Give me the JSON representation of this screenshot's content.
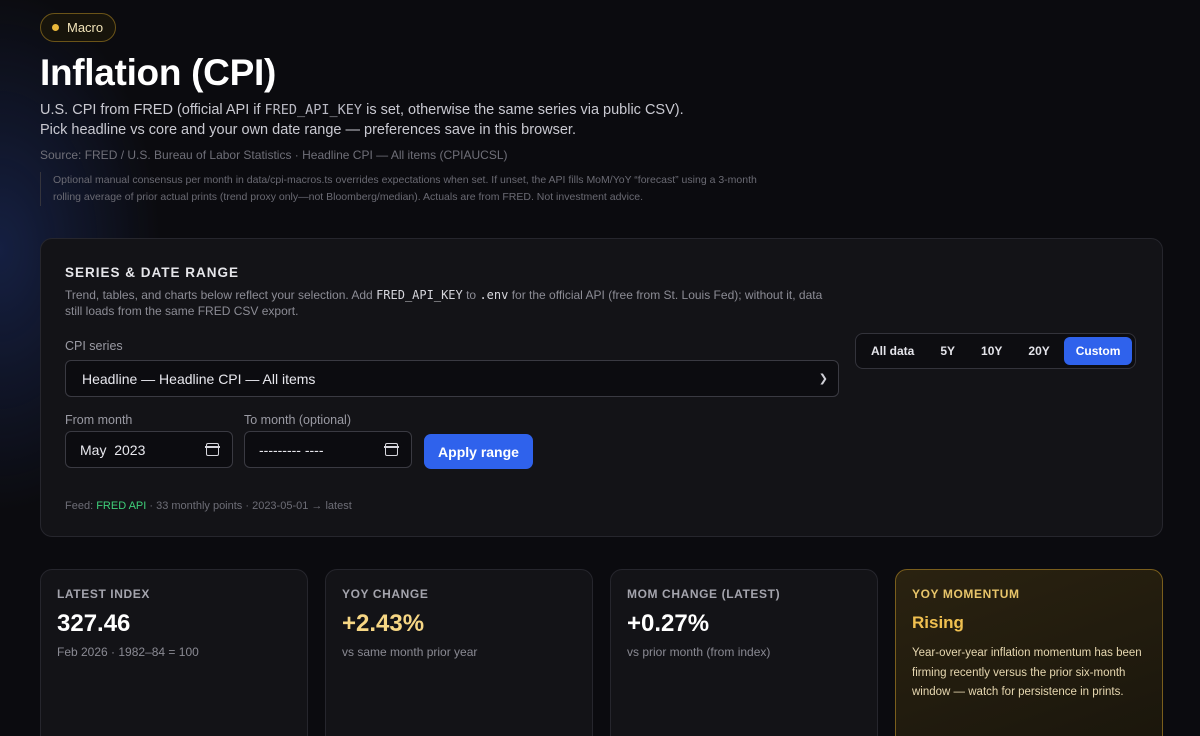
{
  "badge": {
    "label": "Macro"
  },
  "header": {
    "title": "Inflation (CPI)",
    "desc_1": "U.S. CPI from FRED (official API if ",
    "desc_code": "FRED_API_KEY",
    "desc_2": " is set, otherwise the same series via public CSV). Pick headline vs core and your own date range — preferences save in this browser.",
    "source": "Source: FRED / U.S. Bureau of Labor Statistics · Headline CPI — All items (CPIAUCSL)",
    "note": "Optional manual consensus per month in data/cpi-macros.ts overrides expectations when set. If unset, the API fills MoM/YoY “forecast” using a 3-month rolling average of prior actual prints (trend proxy only—not Bloomberg/median). Actuals are from FRED. Not investment advice."
  },
  "panel": {
    "title": "SERIES & DATE RANGE",
    "desc_1": "Trend, tables, and charts below reflect your selection. Add ",
    "desc_code_1": "FRED_API_KEY",
    "desc_2": " to ",
    "desc_code_2": ".env",
    "desc_3": " for the official API (free from St. Louis Fed); without it, data still loads from the same FRED CSV export.",
    "ranges": [
      "All data",
      "5Y",
      "10Y",
      "20Y",
      "Custom"
    ],
    "series_label": "CPI series",
    "series_value": "Headline — Headline CPI — All items",
    "from_label": "From month",
    "from_value": "May  2023",
    "to_label": "To month (optional)",
    "to_value": "--------- ----",
    "apply_label": "Apply range",
    "feed_prefix": "Feed: ",
    "feed_api": "FRED API",
    "feed_suffix": " · 33 monthly points · 2023-05-01 → latest"
  },
  "cards": {
    "latest": {
      "label": "LATEST INDEX",
      "value": "327.46",
      "sub": "Feb 2026 · 1982–84 = 100"
    },
    "yoy": {
      "label": "YOY CHANGE",
      "value": "+2.43%",
      "sub": "vs same month prior year"
    },
    "mom": {
      "label": "MOM CHANGE (LATEST)",
      "value": "+0.27%",
      "sub": "vs prior month (from index)"
    },
    "momentum": {
      "label": "YOY MOMENTUM",
      "value": "Rising",
      "body": "Year-over-year inflation momentum has been firming recently versus the prior six-month window — watch for persistence in prints."
    }
  }
}
